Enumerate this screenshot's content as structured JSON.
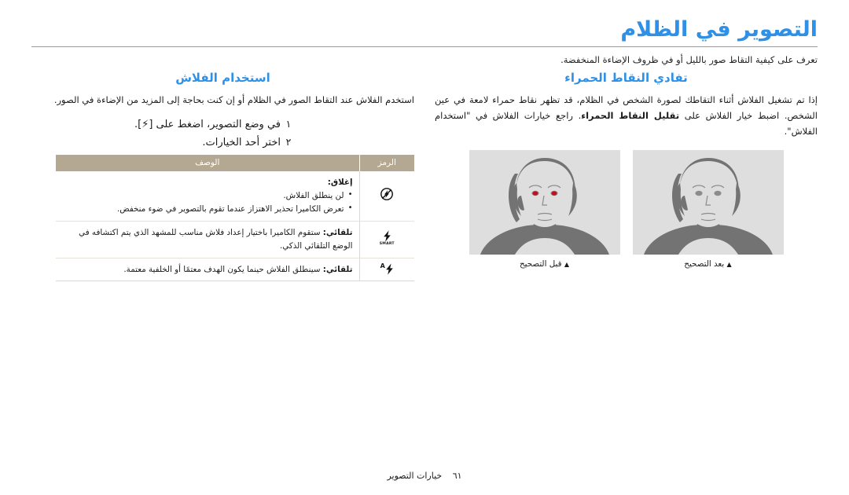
{
  "header": {
    "title": "التصوير في الظلام",
    "subtitle": "تعرف على كيفية التقاط صور بالليل أو في ظروف الإضاءة المنخفضة.",
    "title_color": "#2e90e6",
    "rule_color": "#9a9a9a"
  },
  "left_column": {
    "heading": "استخدام الفلاش",
    "intro": "استخدم الفلاش عند التقاط الصور في الظلام أو إن كنت بحاجة إلى المزيد من الإضاءة في الصور.",
    "steps": [
      {
        "num": "١",
        "text_before": "في وضع التصوير، اضغط على [",
        "key_icon": "flash-bolt-icon",
        "text_after": "]."
      },
      {
        "num": "٢",
        "text_before": "اختر أحد الخيارات.",
        "key_icon": "",
        "text_after": ""
      }
    ],
    "table": {
      "header_bg": "#b4a893",
      "columns": [
        "الرمز",
        "الوصف"
      ],
      "rows": [
        {
          "icon": "flash-off-icon",
          "label": "إغلاق:",
          "bullets": [
            "لن ينطلق الفلاش.",
            "تعرض الكاميرا تحذير الاهتزاز   عندما تقوم بالتصوير في ضوء منخفض."
          ],
          "text": ""
        },
        {
          "icon": "flash-smart-icon",
          "icon_caption": "SMART",
          "label": "تلقائي:",
          "bullets": [],
          "text": "ستقوم الكاميرا باختيار إعداد فلاش مناسب للمشهد الذي يتم اكتشافه في الوضع التلقائي الذكي."
        },
        {
          "icon": "flash-auto-icon",
          "icon_caption": "A",
          "label": "تلقائي:",
          "bullets": [],
          "text": "سينطلق الفلاش حينما يكون الهدف معتمًا أو الخلفية معتمة."
        }
      ]
    }
  },
  "right_column": {
    "heading": "تفادي النقاط الحمراء",
    "paragraph_part1": "إذا تم تشغيل الفلاش أثناء التقاطك لصورة الشخص في الظلام، قد تظهر نقاط حمراء لامعة في عين الشخص. اضبط خيار الفلاش على ",
    "paragraph_bold": "تقليل النقاط الحمراء",
    "paragraph_part2": ". راجع خيارات الفلاش في \"استخدام الفلاش\".",
    "samples": [
      {
        "caption": "قبل التصحيح",
        "red_eye": true,
        "bg": "#dedede",
        "figure_color": "#737373"
      },
      {
        "caption": "بعد التصحيح",
        "red_eye": false,
        "bg": "#dedede",
        "figure_color": "#737373"
      }
    ],
    "red_eye_color": "#c40d1e"
  },
  "footer": {
    "section": "خيارات التصوير",
    "page_number": "٦١"
  }
}
